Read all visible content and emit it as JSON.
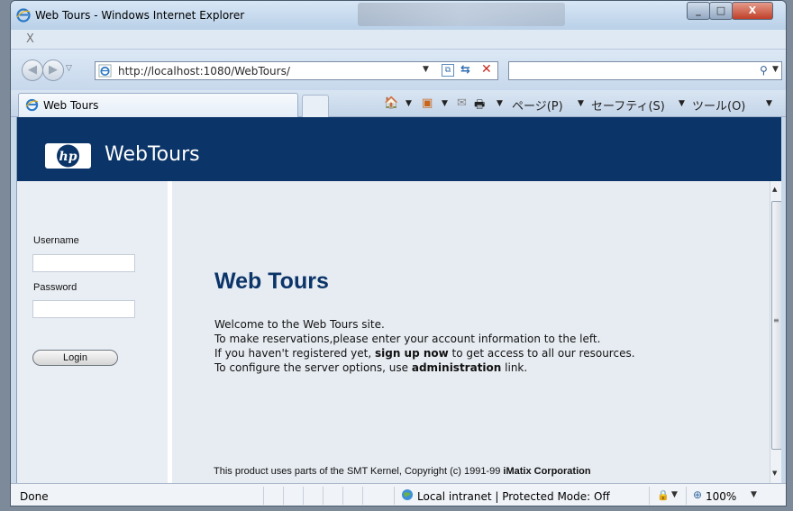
{
  "window": {
    "title": "Web Tours - Windows Internet Explorer",
    "min_icon": "_",
    "max_icon": "□",
    "close_icon": "X"
  },
  "xbar": {
    "close_label": "X"
  },
  "address_bar": {
    "url": "http://localhost:1080/WebTours/",
    "search_placeholder": ""
  },
  "tabs": [
    {
      "label": "Web Tours"
    }
  ],
  "commands": {
    "home": "🏠",
    "feeds": "▣",
    "mail": "✉",
    "print": "🖶",
    "page": "ページ(P)",
    "safety": "セーフティ(S)",
    "tools": "ツール(O)"
  },
  "header": {
    "brand": "WebTours",
    "logo_text": "hp"
  },
  "login": {
    "username_label": "Username",
    "password_label": "Password",
    "username_value": "",
    "password_value": "",
    "login_button": "Login"
  },
  "main": {
    "title": "Web Tours",
    "line1": "Welcome to the Web Tours site.",
    "line2": "To make reservations,please enter your account information to the left.",
    "line3_pre": "If you haven't registered yet, ",
    "line3_link": "sign up now",
    "line3_post": " to get access to all our resources.",
    "line4_pre": "To configure the server options, use ",
    "line4_link": "administration",
    "line4_post": " link.",
    "footer_pre": "This product uses parts of the SMT Kernel, Copyright (c) 1991-99 ",
    "footer_bold": "iMatix Corporation"
  },
  "status": {
    "text": "Done",
    "zone": "Local intranet | Protected Mode: Off",
    "zoom": "100%"
  },
  "colors": {
    "header_bg": "#0b3468",
    "title_color": "#0b3468",
    "stop_red": "#c62a1f"
  }
}
